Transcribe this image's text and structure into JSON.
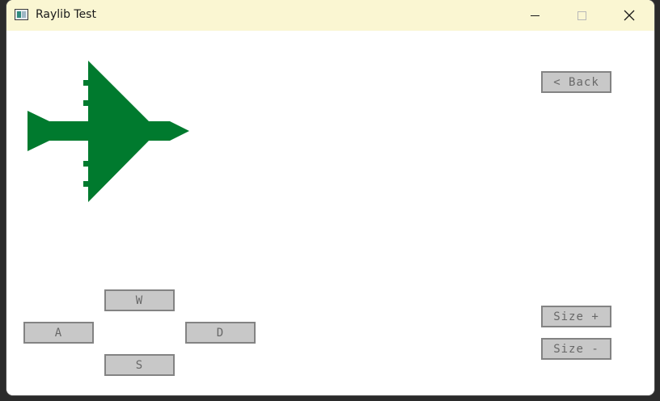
{
  "window": {
    "title": "Raylib Test"
  },
  "controls": {
    "back": "< Back",
    "up": "W",
    "left": "A",
    "right": "D",
    "down": "S",
    "size_plus": "Size +",
    "size_minus": "Size -"
  },
  "colors": {
    "titlebar": "#faf6d2",
    "plane": "#007a2e",
    "button_fill": "#c8c8c8",
    "button_border": "#838383",
    "button_text": "#686868"
  },
  "icons": {
    "app": "app-window-icon",
    "minimize": "minimize-icon",
    "maximize": "maximize-icon",
    "close": "close-icon",
    "sprite": "airplane-sprite"
  }
}
